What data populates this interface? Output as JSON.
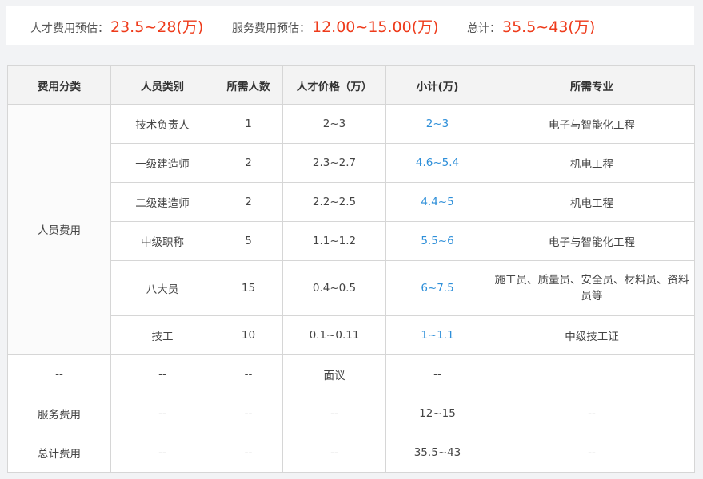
{
  "summary": {
    "talent_label": "人才费用预估：",
    "talent_value": "23.5~28(万)",
    "service_label": "服务费用预估：",
    "service_value": "12.00~15.00(万)",
    "total_label": "总计：",
    "total_value": "35.5~43(万)"
  },
  "table": {
    "headers": [
      "费用分类",
      "人员类别",
      "所需人数",
      "人才价格（万）",
      "小计(万)",
      "所需专业"
    ],
    "personnel_category": "人员费用",
    "rows": [
      {
        "type": "技术负责人",
        "count": "1",
        "price": "2~3",
        "subtotal": "2~3",
        "major": "电子与智能化工程"
      },
      {
        "type": "一级建造师",
        "count": "2",
        "price": "2.3~2.7",
        "subtotal": "4.6~5.4",
        "major": "机电工程"
      },
      {
        "type": "二级建造师",
        "count": "2",
        "price": "2.2~2.5",
        "subtotal": "4.4~5",
        "major": "机电工程"
      },
      {
        "type": "中级职称",
        "count": "5",
        "price": "1.1~1.2",
        "subtotal": "5.5~6",
        "major": "电子与智能化工程"
      },
      {
        "type": "八大员",
        "count": "15",
        "price": "0.4~0.5",
        "subtotal": "6~7.5",
        "major": "施工员、质量员、安全员、材料员、资料员等"
      },
      {
        "type": "技工",
        "count": "10",
        "price": "0.1~0.11",
        "subtotal": "1~1.1",
        "major": "中级技工证"
      }
    ],
    "other_row": {
      "category": "--",
      "type": "--",
      "count": "--",
      "price": "面议",
      "subtotal": "--",
      "major": ""
    },
    "service_row": {
      "category": "服务费用",
      "type": "--",
      "count": "--",
      "price": "--",
      "subtotal": "12~15",
      "major": "--"
    },
    "total_row": {
      "category": "总计费用",
      "type": "--",
      "count": "--",
      "price": "--",
      "subtotal": "35.5~43",
      "major": "--"
    }
  },
  "colors": {
    "accent_red": "#ee3b1b",
    "link_blue": "#2e8fd9"
  }
}
